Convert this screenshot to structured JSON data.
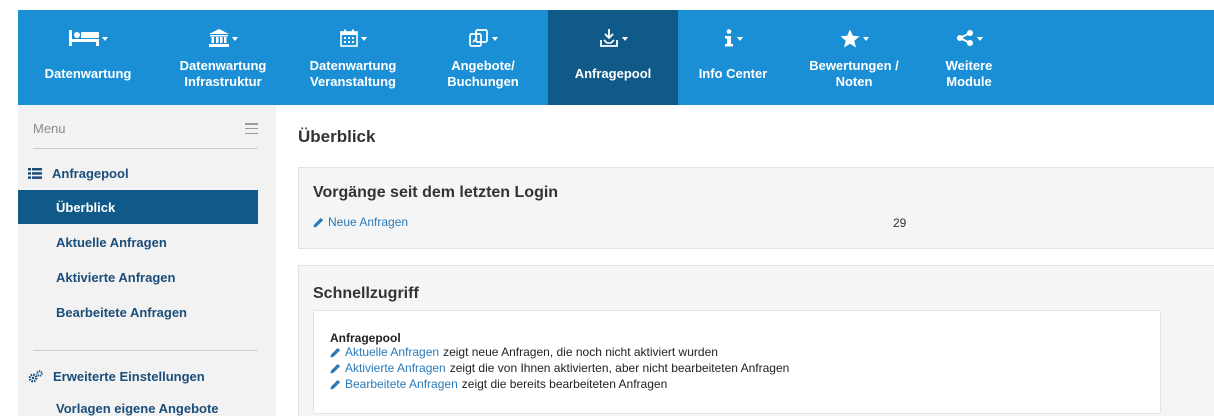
{
  "nav": {
    "items": [
      {
        "icon": "bed-icon",
        "label": "Datenwartung"
      },
      {
        "icon": "bank-icon",
        "label": "Datenwartung\nInfrastruktur"
      },
      {
        "icon": "calendar-icon",
        "label": "Datenwartung\nVeranstaltung"
      },
      {
        "icon": "offers-icon",
        "label": "Angebote/\nBuchungen"
      },
      {
        "icon": "inbox-icon",
        "label": "Anfragepool"
      },
      {
        "icon": "info-icon",
        "label": "Info Center"
      },
      {
        "icon": "star-icon",
        "label": "Bewertungen /\nNoten"
      },
      {
        "icon": "share-icon",
        "label": "Weitere\nModule"
      }
    ]
  },
  "sidebar": {
    "menu_title": "Menu",
    "section1": {
      "icon": "list-icon",
      "label": "Anfragepool"
    },
    "items": [
      {
        "label": "Überblick"
      },
      {
        "label": "Aktuelle Anfragen"
      },
      {
        "label": "Aktivierte Anfragen"
      },
      {
        "label": "Bearbeitete Anfragen"
      }
    ],
    "section2": {
      "icon": "cogs-icon",
      "label": "Erweiterte Einstellungen"
    },
    "section2_items": [
      {
        "label": "Vorlagen eigene Angebote"
      }
    ]
  },
  "main": {
    "title": "Überblick",
    "since_login": {
      "title": "Vorgänge seit dem letzten Login",
      "link": "Neue Anfragen",
      "count": "29"
    },
    "quick": {
      "title": "Schnellzugriff",
      "box_title": "Anfragepool",
      "lines": [
        {
          "link": "Aktuelle Anfragen",
          "text": "zeigt neue Anfragen, die noch nicht aktiviert wurden"
        },
        {
          "link": "Aktivierte Anfragen",
          "text": "zeigt die von Ihnen aktivierten, aber nicht bearbeiteten Anfragen"
        },
        {
          "link": "Bearbeitete Anfragen",
          "text": "zeigt die bereits bearbeiteten Anfragen"
        }
      ]
    }
  },
  "colors": {
    "nav_bg": "#1a8fd6",
    "nav_active": "#105a8a",
    "sidebar_bg": "#f2f2f2",
    "link": "#2a7ab8",
    "sidebar_text": "#1a4d79"
  }
}
